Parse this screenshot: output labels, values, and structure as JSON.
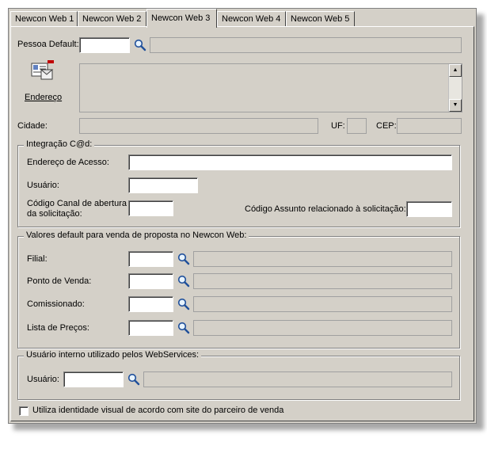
{
  "tabs": [
    "Newcon Web 1",
    "Newcon Web 2",
    "Newcon Web 3",
    "Newcon Web 4",
    "Newcon Web 5"
  ],
  "active_tab": "Newcon Web 3",
  "pessoa": {
    "label": "Pessoa Default:",
    "endereco_label": "Endereço",
    "cidade_label": "Cidade:",
    "uf_label": "UF:",
    "cep_label": "CEP:"
  },
  "integracao": {
    "title": "Integração C@d:",
    "endereco_acesso_label": "Endereço de Acesso:",
    "usuario_label": "Usuário:",
    "codigo_canal_label_1": "Código Canal de abertura",
    "codigo_canal_label_2": "da solicitação:",
    "codigo_assunto_label": "Código Assunto relacionado à solicitação:"
  },
  "valores": {
    "title": "Valores default para venda de proposta no Newcon Web:",
    "filial_label": "Filial:",
    "ponto_venda_label": "Ponto de Venda:",
    "comissionado_label": "Comissionado:",
    "lista_precos_label": "Lista de Preços:"
  },
  "usuario_interno": {
    "title": "Usuário interno utilizado pelos WebServices:",
    "usuario_label": "Usuário:"
  },
  "checkbox_label": "Utiliza identidade visual de acordo com site do parceiro de venda",
  "icons": {
    "search": "magnifier-icon",
    "address": "address-card-icon"
  }
}
